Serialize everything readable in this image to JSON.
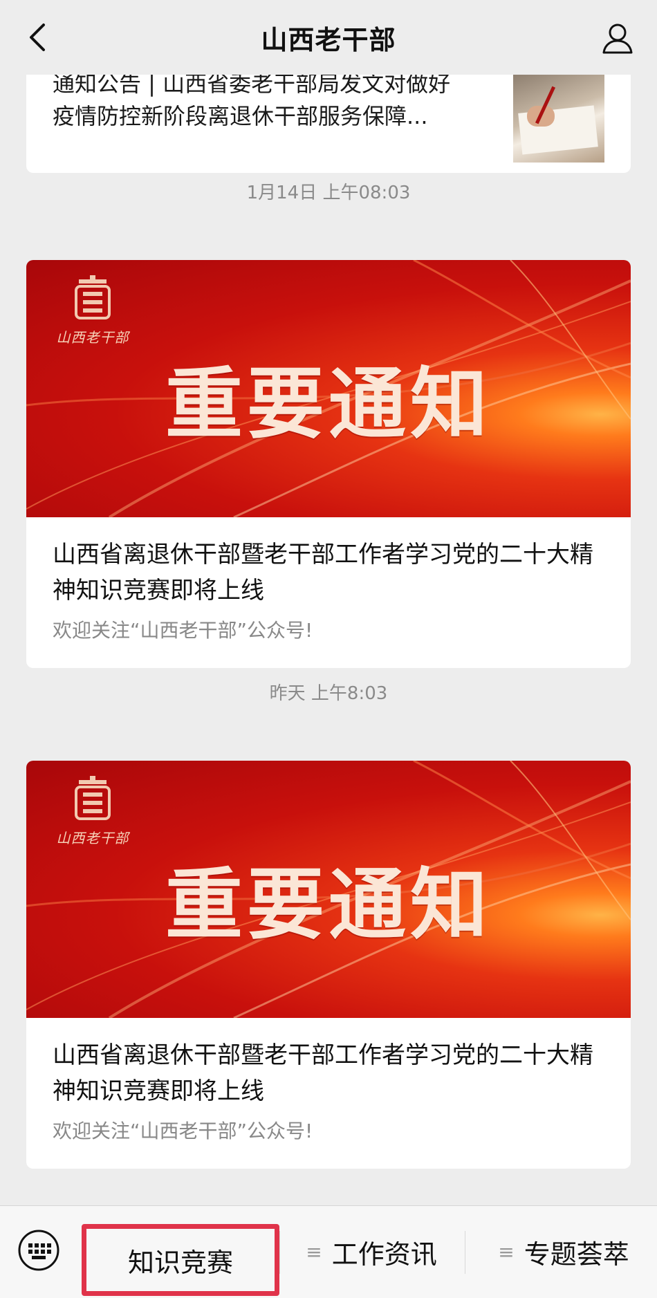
{
  "header": {
    "title": "山西老干部",
    "back_icon": "chevron-left-icon",
    "profile_icon": "user-icon"
  },
  "top_article": {
    "line1": "通知公告 | 山西省委老干部局发文对做好",
    "line2": "疫情防控新阶段离退休干部服务保障..."
  },
  "messages": [
    {
      "timestamp": "1月14日 上午08:03",
      "banner_text": "重要通知",
      "logo_text": "山西老干部",
      "headline": "山西省离退休干部暨老干部工作者学习党的二十大精神知识竞赛即将上线",
      "digest": "欢迎关注“山西老干部”公众号!"
    },
    {
      "timestamp": "昨天 上午8:03",
      "banner_text": "重要通知",
      "logo_text": "山西老干部",
      "headline": "山西省离退休干部暨老干部工作者学习党的二十大精神知识竞赛即将上线",
      "digest": "欢迎关注“山西老干部”公众号!"
    }
  ],
  "bottom_menu": {
    "keyboard_icon": "keyboard-icon",
    "items": [
      {
        "label": "知识竞赛",
        "highlighted": true
      },
      {
        "label": "工作资讯",
        "icon": "menu-lines-icon"
      },
      {
        "label": "专题荟萃",
        "icon": "menu-lines-icon"
      }
    ]
  },
  "colors": {
    "background": "#ededed",
    "banner_red": "#c8100c",
    "highlight_border": "#e0334a"
  }
}
